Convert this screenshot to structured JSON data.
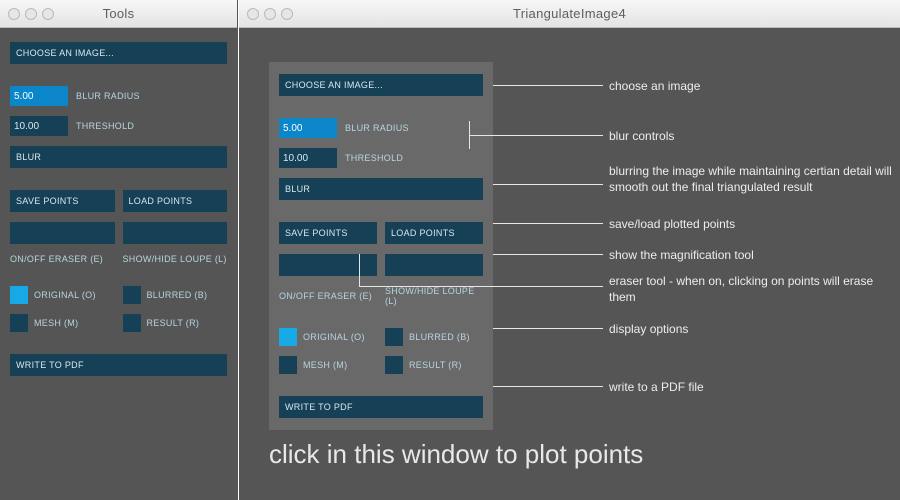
{
  "left": {
    "title": "Tools",
    "choose": "CHOOSE AN IMAGE...",
    "blur_radius_val": "5.00",
    "blur_radius_lbl": "BLUR RADIUS",
    "threshold_val": "10.00",
    "threshold_lbl": "THRESHOLD",
    "blur_btn": "BLUR",
    "save_pts": "SAVE POINTS",
    "load_pts": "LOAD POINTS",
    "eraser_btn": "",
    "eraser_lbl": "ON/OFF ERASER (E)",
    "loupe_btn": "",
    "loupe_lbl": "SHOW/HIDE LOUPE (L)",
    "original": "ORIGINAL (O)",
    "blurred": "BLURRED (B)",
    "mesh": "MESH (M)",
    "result": "RESULT (R)",
    "write_pdf": "WRITE TO PDF"
  },
  "right": {
    "title": "TriangulateImage4",
    "annotations": {
      "choose": "choose an image",
      "blur_controls": "blur controls",
      "blur_desc": "blurring the image while maintaining certian detail will smooth out the final triangulated result",
      "save_load": "save/load plotted points",
      "loupe": "show the magnification tool",
      "eraser": "eraser tool - when on, clicking on points will erase them",
      "display": "display options",
      "pdf": "write to a PDF file"
    },
    "big": "click in this window to plot points"
  }
}
